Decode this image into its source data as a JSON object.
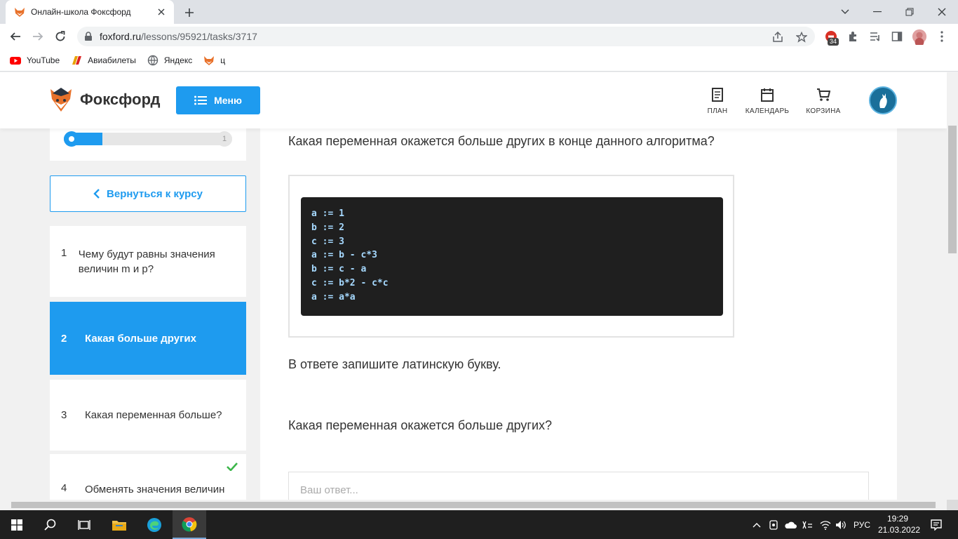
{
  "browser": {
    "tab_title": "Онлайн-школа Фоксфорд",
    "url_host": "foxford.ru",
    "url_path": "/lessons/95921/tasks/3717",
    "extension_badge": "34"
  },
  "bookmarks": [
    {
      "label": "YouTube",
      "icon": "youtube-icon"
    },
    {
      "label": "Авиабилеты",
      "icon": "flight-icon"
    },
    {
      "label": "Яндекс",
      "icon": "globe-icon"
    },
    {
      "label": "ц",
      "icon": "fox-icon"
    }
  ],
  "site": {
    "brand": "Фоксфорд",
    "menu_label": "Меню",
    "nav": {
      "plan": "ПЛАН",
      "calendar": "КАЛЕНДАРЬ",
      "cart": "КОРЗИНА"
    },
    "accent_color": "#1e9bef"
  },
  "sidebar": {
    "progress_end_label": "1",
    "progress_fraction": 0.23,
    "back_label": "Вернуться к курсу",
    "tasks": [
      {
        "num": "1",
        "text": "Чему будут равны значения величин m и p?"
      },
      {
        "num": "2",
        "text": "Какая больше других"
      },
      {
        "num": "3",
        "text": "Какая переменная больше?"
      },
      {
        "num": "4",
        "text": "Обменять значения величин"
      }
    ]
  },
  "task": {
    "question": "Какая переменная окажется больше других в конце данного алгоритма?",
    "code": [
      "a := 1",
      "b := 2",
      "c := 3",
      "a := b - c*3",
      "b := c - a",
      "c := b*2 - c*c",
      "a := a*a"
    ],
    "instruction": "В ответе запишите латинскую букву.",
    "prompt": "Какая переменная окажется больше других?",
    "answer_placeholder": "Ваш ответ..."
  },
  "taskbar": {
    "lang": "РУС",
    "time": "19:29",
    "date": "21.03.2022"
  }
}
